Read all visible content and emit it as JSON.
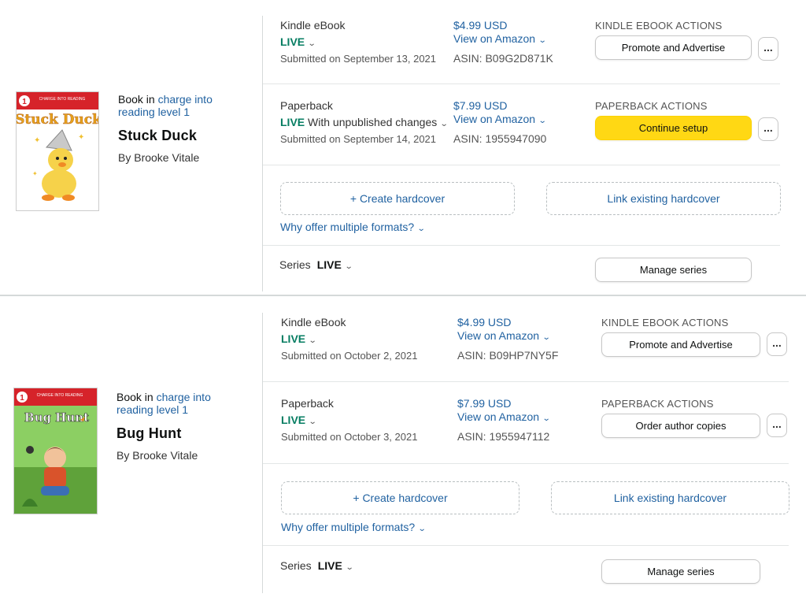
{
  "books": [
    {
      "book_in_prefix": "Book in",
      "series_link": "charge into reading level 1",
      "title": "Stuck Duck",
      "author": "By Brooke Vitale",
      "cover": {
        "badge": "1",
        "series_text": "CHARGE INTO READING",
        "title": "Stuck Duck",
        "bg": "#ffffff",
        "accent": "#d6232a",
        "title_color": "#e8a31a"
      },
      "kindle": {
        "format": "Kindle eBook",
        "status": "LIVE",
        "status_extra": "",
        "submitted": "Submitted on September 13, 2021",
        "price": "$4.99 USD",
        "view": "View on Amazon",
        "asin": "ASIN: B09G2D871K",
        "actions_label": "KINDLE EBOOK ACTIONS",
        "action_button": "Promote and Advertise",
        "more": "..."
      },
      "paperback": {
        "format": "Paperback",
        "status": "LIVE",
        "status_extra": "With unpublished changes",
        "submitted": "Submitted on September 14, 2021",
        "price": "$7.99 USD",
        "view": "View on Amazon",
        "asin": "ASIN: 1955947090",
        "actions_label": "PAPERBACK ACTIONS",
        "action_button": "Continue setup",
        "more": "..."
      },
      "create_hardcover": "+ Create hardcover",
      "link_hardcover": "Link existing hardcover",
      "why_formats": "Why offer multiple formats?",
      "series_label": "Series",
      "series_status": "LIVE",
      "manage_series": "Manage series"
    },
    {
      "book_in_prefix": "Book in",
      "series_link": "charge into reading level 1",
      "title": "Bug Hunt",
      "author": "By Brooke Vitale",
      "cover": {
        "badge": "1",
        "series_text": "CHARGE INTO READING",
        "title": "Bug Hunt",
        "bg": "#7dbf57",
        "accent": "#d6232a",
        "title_color": "#ffffff"
      },
      "kindle": {
        "format": "Kindle eBook",
        "status": "LIVE",
        "status_extra": "",
        "submitted": "Submitted on October 2, 2021",
        "price": "$4.99 USD",
        "view": "View on Amazon",
        "asin": "ASIN: B09HP7NY5F",
        "actions_label": "KINDLE EBOOK ACTIONS",
        "action_button": "Promote and Advertise",
        "more": "..."
      },
      "paperback": {
        "format": "Paperback",
        "status": "LIVE",
        "status_extra": "",
        "submitted": "Submitted on October 3, 2021",
        "price": "$7.99 USD",
        "view": "View on Amazon",
        "asin": "ASIN: 1955947112",
        "actions_label": "PAPERBACK ACTIONS",
        "action_button": "Order author copies",
        "more": "..."
      },
      "create_hardcover": "+ Create hardcover",
      "link_hardcover": "Link existing hardcover",
      "why_formats": "Why offer multiple formats?",
      "series_label": "Series",
      "series_status": "LIVE",
      "manage_series": "Manage series"
    }
  ],
  "colors": {
    "live": "#067d62",
    "link": "#2162a1",
    "primary_button": "#ffd814"
  }
}
